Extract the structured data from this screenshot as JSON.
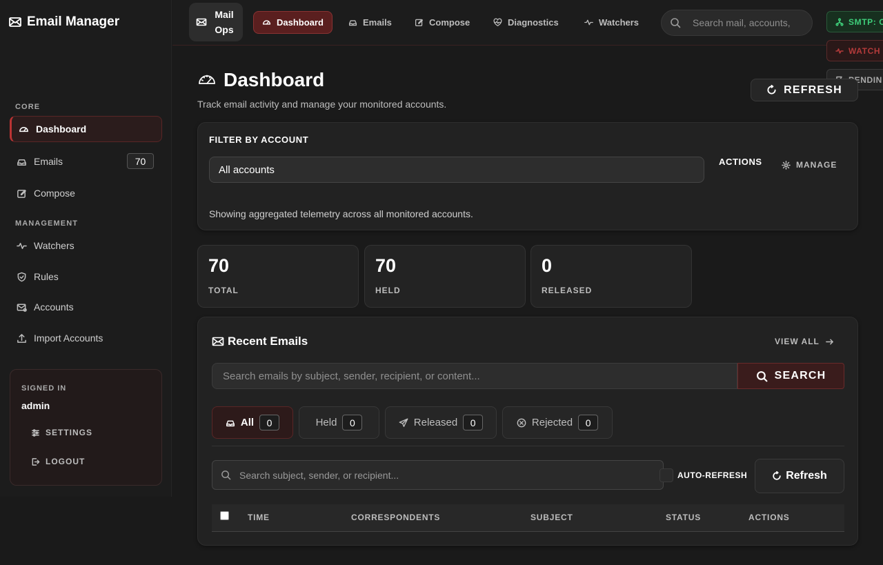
{
  "sidebar": {
    "brand": "Email Manager",
    "core_label": "CORE",
    "management_label": "MANAGEMENT",
    "items": [
      {
        "label": "Dashboard",
        "icon": "gauge-icon"
      },
      {
        "label": "Emails",
        "icon": "inbox-icon",
        "badge": "70"
      },
      {
        "label": "Compose",
        "icon": "edit-icon"
      },
      {
        "label": "Watchers",
        "icon": "pulse-icon"
      },
      {
        "label": "Rules",
        "icon": "shield-icon"
      },
      {
        "label": "Accounts",
        "icon": "mail-cog-icon"
      },
      {
        "label": "Import Accounts",
        "icon": "upload-icon"
      }
    ],
    "user": {
      "signed_in_label": "SIGNED IN",
      "name": "admin",
      "settings": "SETTINGS",
      "logout": "LOGOUT"
    }
  },
  "topbar": {
    "ops_label": "Mail Ops",
    "nav": [
      "Dashboard",
      "Emails",
      "Compose",
      "Diagnostics",
      "Watchers"
    ],
    "search_placeholder": "Search mail, accounts,",
    "status": {
      "smtp": "SMTP: O",
      "watchers": "WATCH",
      "pending": "PENDIN"
    }
  },
  "page": {
    "title": "Dashboard",
    "subtitle": "Track email activity and manage your monitored accounts.",
    "refresh": "REFRESH"
  },
  "filter": {
    "label": "FILTER BY ACCOUNT",
    "selected": "All accounts",
    "actions_label": "ACTIONS",
    "manage": "MANAGE",
    "note": "Showing aggregated telemetry across all monitored accounts."
  },
  "stats": [
    {
      "value": "70",
      "label": "TOTAL"
    },
    {
      "value": "70",
      "label": "HELD"
    },
    {
      "value": "0",
      "label": "RELEASED"
    }
  ],
  "recent": {
    "title": "Recent Emails",
    "view_all": "VIEW ALL",
    "search_placeholder": "Search emails by subject, sender, recipient, or content...",
    "search_button": "SEARCH",
    "chips": [
      {
        "label": "All",
        "count": "0"
      },
      {
        "label": "Held",
        "count": "0"
      },
      {
        "label": "Released",
        "count": "0"
      },
      {
        "label": "Rejected",
        "count": "0"
      }
    ],
    "filter_placeholder": "Search subject, sender, or recipient...",
    "auto_refresh": "AUTO-REFRESH",
    "refresh": "Refresh",
    "columns": [
      "TIME",
      "CORRESPONDENTS",
      "SUBJECT",
      "STATUS",
      "ACTIONS"
    ]
  },
  "colors": {
    "accent": "#b33a3a",
    "background": "#1a1a1a",
    "smtp_ok": "#3ecf7a"
  }
}
